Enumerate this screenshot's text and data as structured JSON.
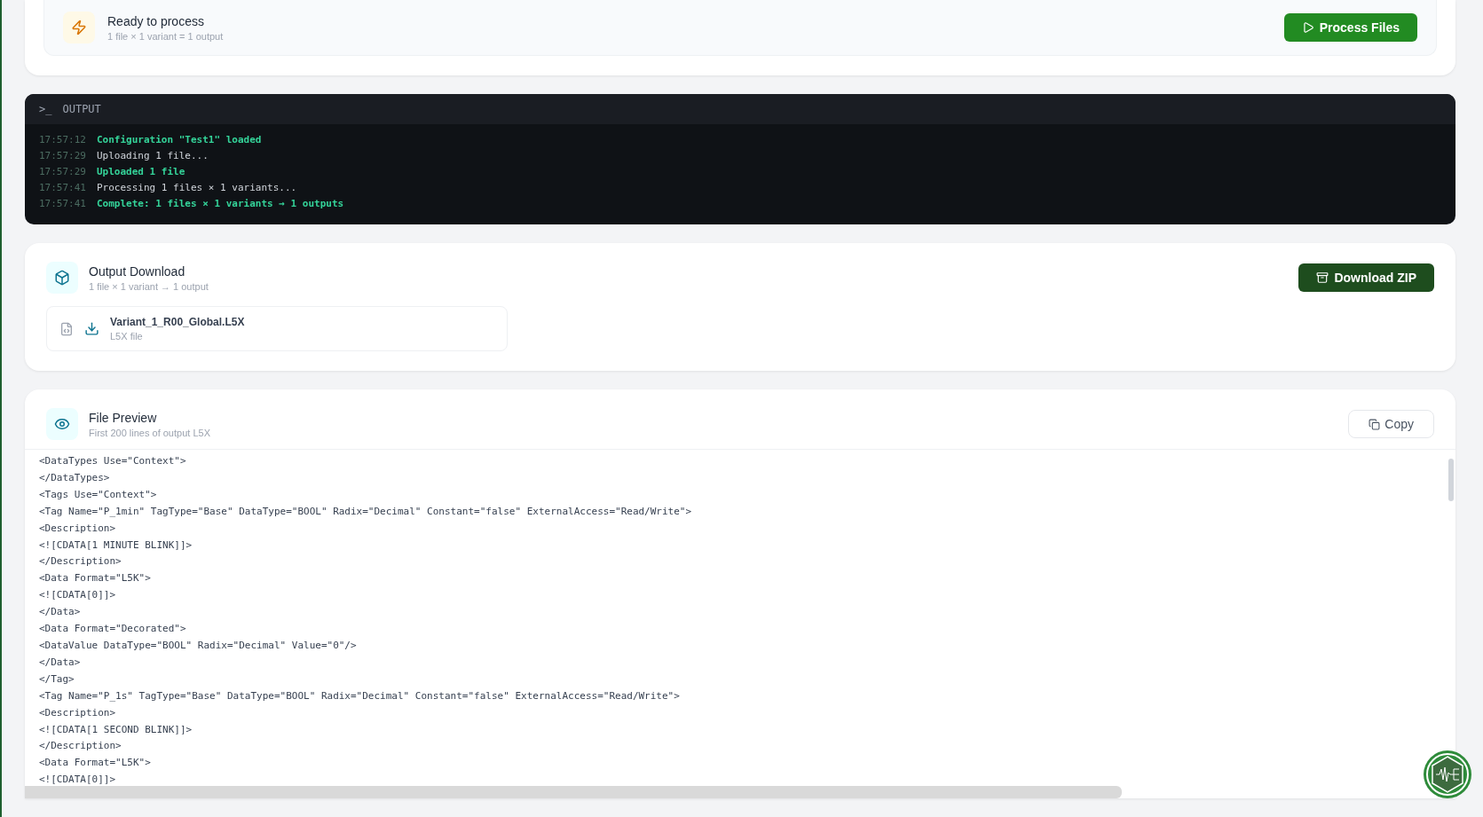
{
  "process": {
    "title": "Ready to process",
    "subtitle": "1 file × 1 variant = 1 output",
    "button": "Process Files"
  },
  "output": {
    "title": "OUTPUT",
    "prompt": ">_",
    "lines": [
      {
        "time": "17:57:12",
        "text": "Configuration \"Test1\" loaded",
        "kind": "success"
      },
      {
        "time": "17:57:29",
        "text": "Uploading 1 file...",
        "kind": "info"
      },
      {
        "time": "17:57:29",
        "text": "Uploaded 1 file",
        "kind": "success"
      },
      {
        "time": "17:57:41",
        "text": "Processing 1 files × 1 variants...",
        "kind": "info"
      },
      {
        "time": "17:57:41",
        "text": "Complete: 1 files × 1 variants → 1 outputs",
        "kind": "success"
      }
    ]
  },
  "download": {
    "title": "Output Download",
    "subtitle": "1 file × 1 variant → 1 output",
    "button": "Download ZIP",
    "files": [
      {
        "name": "Variant_1_R00_Global.L5X",
        "type": "L5X file"
      }
    ]
  },
  "preview": {
    "title": "File Preview",
    "subtitle": "First 200 lines of output L5X",
    "button": "Copy",
    "lines": [
      "<DataTypes Use=\"Context\">",
      "</DataTypes>",
      "<Tags Use=\"Context\">",
      "<Tag Name=\"P_1min\" TagType=\"Base\" DataType=\"BOOL\" Radix=\"Decimal\" Constant=\"false\" ExternalAccess=\"Read/Write\">",
      "<Description>",
      "<![CDATA[1 MINUTE BLINK]]>",
      "</Description>",
      "<Data Format=\"L5K\">",
      "<![CDATA[0]]>",
      "</Data>",
      "<Data Format=\"Decorated\">",
      "<DataValue DataType=\"BOOL\" Radix=\"Decimal\" Value=\"0\"/>",
      "</Data>",
      "</Tag>",
      "<Tag Name=\"P_1s\" TagType=\"Base\" DataType=\"BOOL\" Radix=\"Decimal\" Constant=\"false\" ExternalAccess=\"Read/Write\">",
      "<Description>",
      "<![CDATA[1 SECOND BLINK]]>",
      "</Description>",
      "<Data Format=\"L5K\">",
      "<![CDATA[0]]>"
    ]
  }
}
